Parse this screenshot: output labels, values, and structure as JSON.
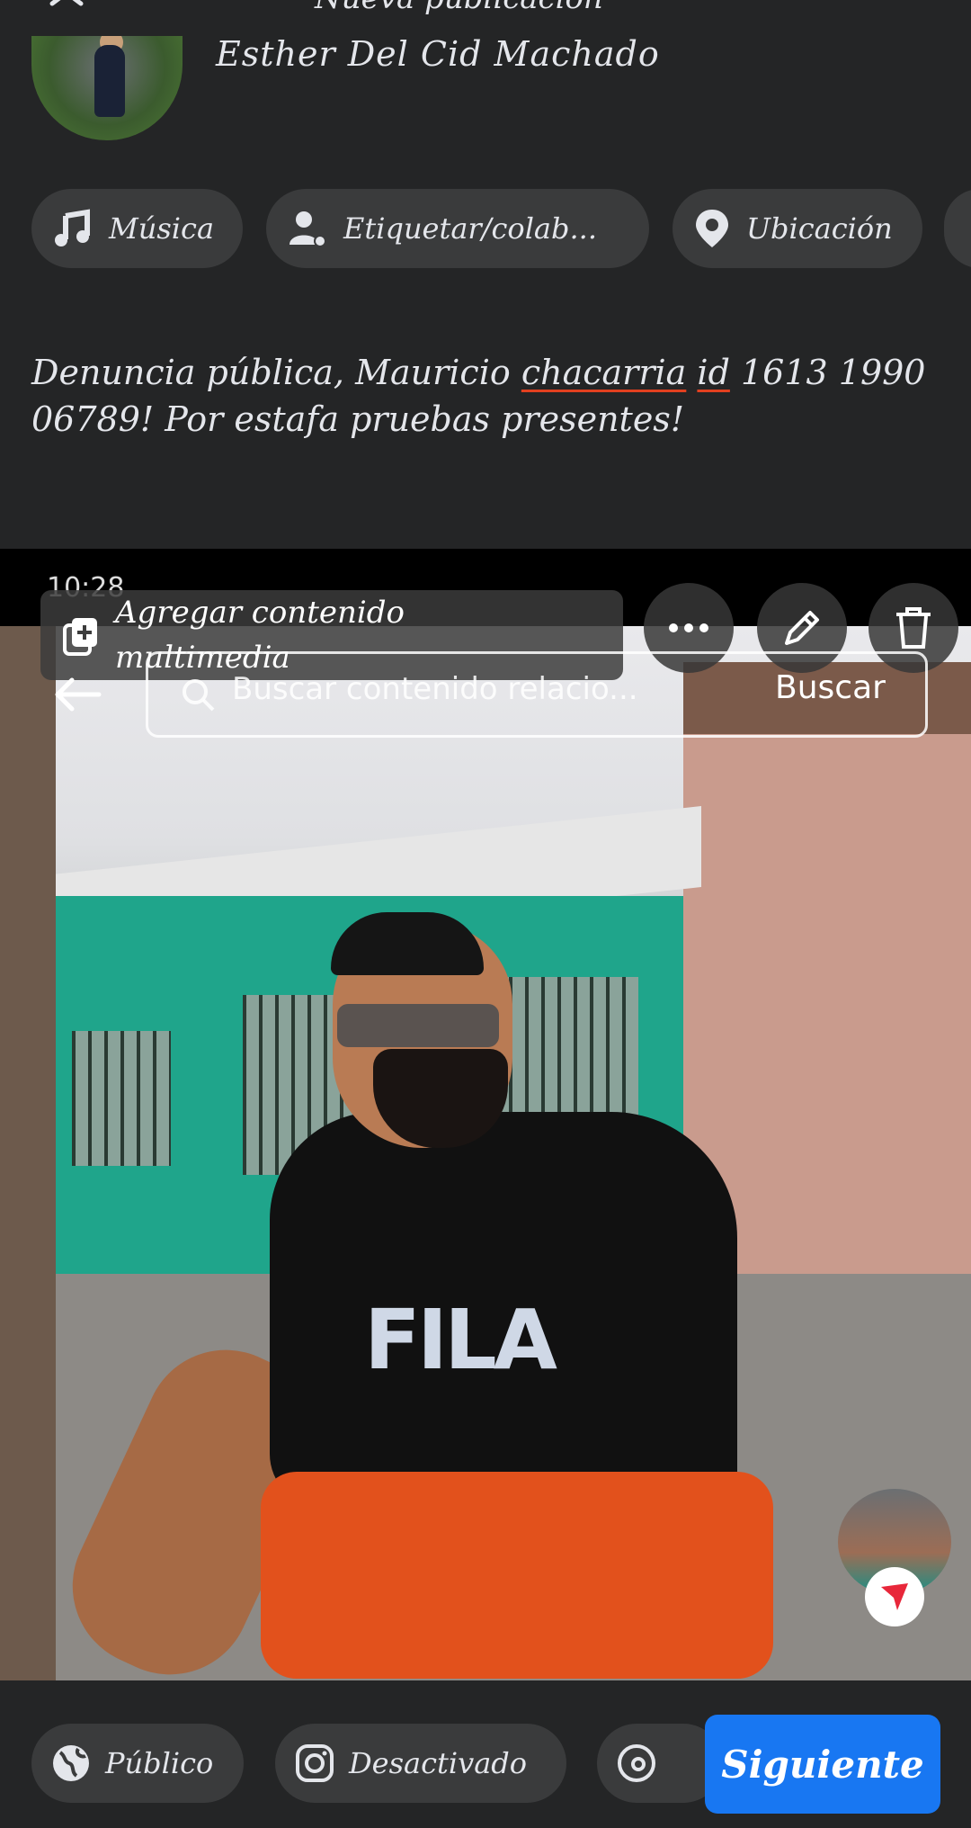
{
  "header": {
    "title": "Nueva publicación",
    "author": "Esther Del Cid Machado"
  },
  "chips": {
    "music": "Música",
    "tag": "Etiquetar/colab...",
    "location": "Ubicación"
  },
  "post": {
    "text_part1": "Denuncia pública, Mauricio ",
    "text_underlined1": "chacarria",
    "text_part2": "  ",
    "text_underlined2": "id",
    "text_part3": " 1613 1990 06789! Por estafa pruebas presentes!"
  },
  "media": {
    "status_time": "10:28",
    "add_media_label": "Agregar contenido multimedia",
    "search_placeholder": "Buscar contenido relacio...",
    "search_button": "Buscar",
    "shirt_brand": "FILA"
  },
  "bottom": {
    "audience": "Público",
    "instagram": "Desactivado",
    "next": "Siguiente"
  },
  "colors": {
    "background": "#242526",
    "chip": "#3a3b3c",
    "primary": "#1877f2"
  }
}
